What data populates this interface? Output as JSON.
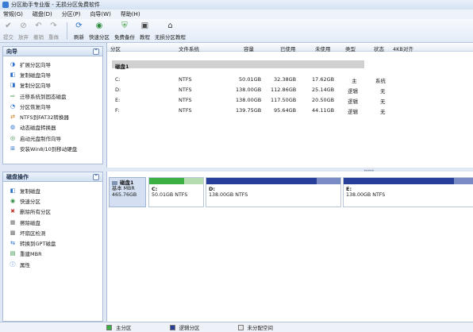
{
  "window": {
    "title": "分区助手专业版 - 无损分区免费软件"
  },
  "menu": [
    "常规(G)",
    "磁盘(D)",
    "分区(P)",
    "向导(W)",
    "帮助(H)"
  ],
  "toolbar": {
    "buttons": [
      {
        "label": "提交",
        "icon": "check-icon",
        "disabled": true
      },
      {
        "label": "放弃",
        "icon": "discard-icon",
        "disabled": true
      },
      {
        "label": "撤销",
        "icon": "undo-icon",
        "disabled": true
      },
      {
        "label": "重做",
        "icon": "redo-icon",
        "disabled": true
      },
      {
        "label": "刷新",
        "icon": "refresh-icon",
        "disabled": false
      },
      {
        "label": "快速分区",
        "icon": "quick-partition-icon",
        "disabled": false
      },
      {
        "label": "免费备份",
        "icon": "backup-icon",
        "disabled": false
      },
      {
        "label": "教程",
        "icon": "tutorial-icon",
        "disabled": false
      },
      {
        "label": "无损分区教程",
        "icon": "lossless-tutorial-icon",
        "disabled": false
      }
    ]
  },
  "wizard_panel": {
    "title": "向导",
    "items": [
      {
        "label": "扩展分区向导",
        "icon": "extend-partition-icon"
      },
      {
        "label": "复制磁盘向导",
        "icon": "copy-disk-icon"
      },
      {
        "label": "复制分区向导",
        "icon": "copy-partition-icon"
      },
      {
        "label": "迁移系统到固态磁盘",
        "icon": "migrate-os-icon"
      },
      {
        "label": "分区恢复向导",
        "icon": "partition-recovery-icon"
      },
      {
        "label": "NTFS到FAT32转换器",
        "icon": "ntfs-fat32-icon"
      },
      {
        "label": "动态磁盘转换器",
        "icon": "dynamic-disk-icon"
      },
      {
        "label": "启动光盘制作向导",
        "icon": "boot-cd-icon"
      },
      {
        "label": "安装Win8/10到移动硬盘",
        "icon": "windows-to-go-icon"
      }
    ]
  },
  "disk_ops_panel": {
    "title": "磁盘操作",
    "items": [
      {
        "label": "复制磁盘",
        "icon": "copy-disk-icon"
      },
      {
        "label": "快速分区",
        "icon": "quick-partition-icon"
      },
      {
        "label": "删除所有分区",
        "icon": "delete-all-icon"
      },
      {
        "label": "擦除磁盘",
        "icon": "wipe-disk-icon"
      },
      {
        "label": "坏扇区检测",
        "icon": "bad-sector-icon"
      },
      {
        "label": "转换到GPT磁盘",
        "icon": "convert-gpt-icon"
      },
      {
        "label": "重建MBR",
        "icon": "rebuild-mbr-icon"
      },
      {
        "label": "属性",
        "icon": "properties-icon"
      }
    ]
  },
  "partition_table": {
    "columns": [
      "分区",
      "文件系统",
      "容量",
      "已使用",
      "未使用",
      "类型",
      "状态",
      "4KB对齐"
    ],
    "disk_label": "磁盘1",
    "rows": [
      {
        "partition": "C:",
        "fs": "NTFS",
        "capacity": "50.01GB",
        "used": "32.38GB",
        "free": "17.62GB",
        "type": "主",
        "status": "系统",
        "align": ""
      },
      {
        "partition": "D:",
        "fs": "NTFS",
        "capacity": "138.00GB",
        "used": "112.86GB",
        "free": "25.14GB",
        "type": "逻辑",
        "status": "无",
        "align": ""
      },
      {
        "partition": "E:",
        "fs": "NTFS",
        "capacity": "138.00GB",
        "used": "117.50GB",
        "free": "20.50GB",
        "type": "逻辑",
        "status": "无",
        "align": ""
      },
      {
        "partition": "F:",
        "fs": "NTFS",
        "capacity": "139.75GB",
        "used": "95.64GB",
        "free": "44.11GB",
        "type": "逻辑",
        "status": "无",
        "align": ""
      }
    ]
  },
  "disk_map": {
    "disk": {
      "name": "磁盘1",
      "type": "基本 MBR",
      "size": "465.76GB"
    },
    "partitions": [
      {
        "label": "C:",
        "size": "50.01GB NTFS",
        "kind": "primary",
        "used_fraction": 0.65
      },
      {
        "label": "D:",
        "size": "138.00GB NTFS",
        "kind": "logical",
        "used_fraction": 0.82
      },
      {
        "label": "E:",
        "size": "138.00GB NTFS",
        "kind": "logical",
        "used_fraction": 0.85
      }
    ]
  },
  "legend": [
    {
      "label": "主分区",
      "color": "#3cb043"
    },
    {
      "label": "逻辑分区",
      "color": "#283f9a"
    },
    {
      "label": "未分配空间",
      "color": "#e8e8e8"
    }
  ],
  "colors": {
    "primary": "#3cb043",
    "logical": "#283f9a",
    "panel_border": "#a9bdd8",
    "disk_band": "#d0d0d0"
  }
}
